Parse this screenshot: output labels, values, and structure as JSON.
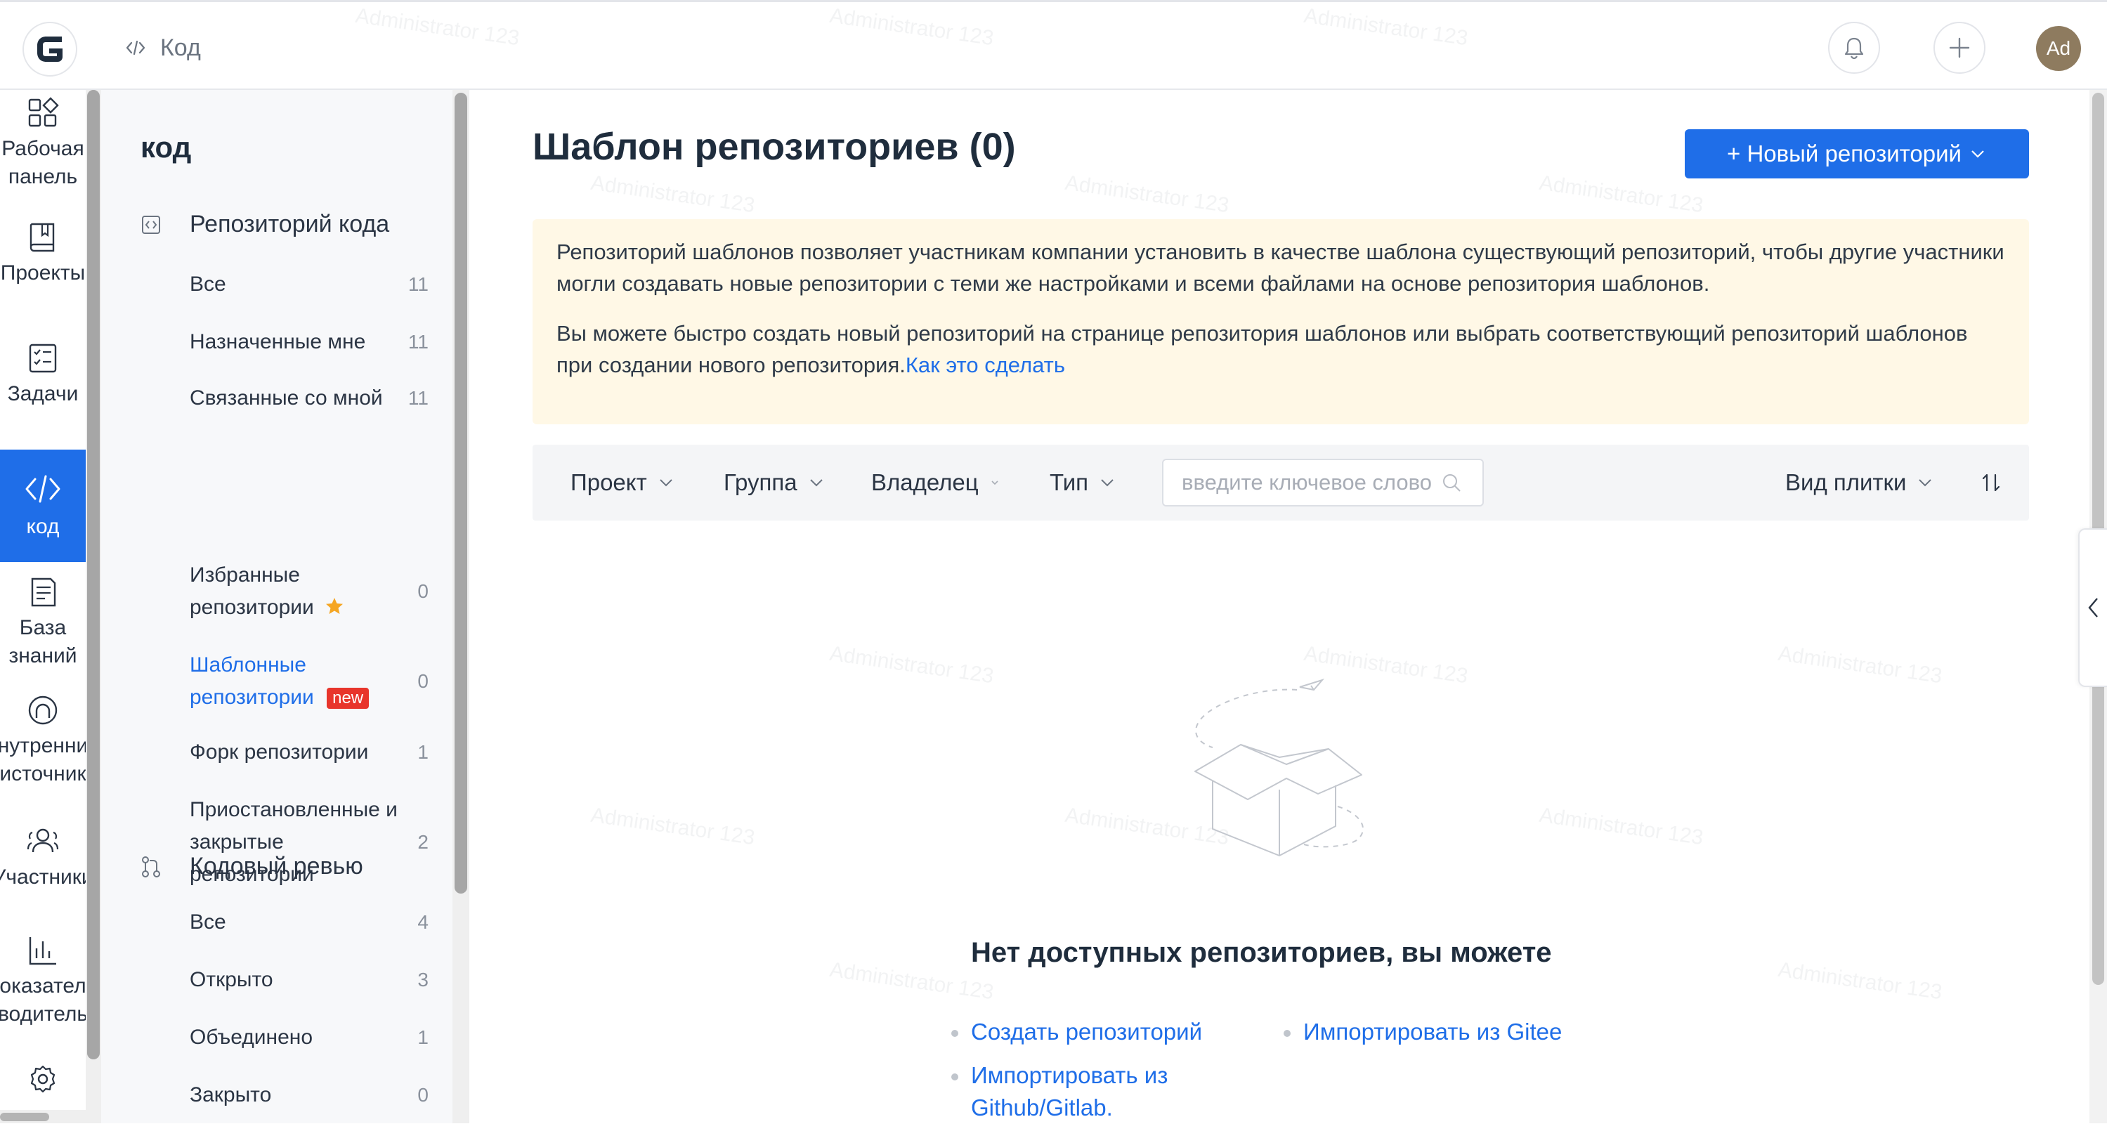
{
  "header": {
    "breadcrumb": "Код",
    "avatar_initials": "Ad"
  },
  "rail": {
    "items": [
      {
        "label_line1": "Рабочая",
        "label_line2": "панель",
        "icon": "dashboard-icon"
      },
      {
        "label_line1": "Проекты",
        "label_line2": "",
        "icon": "book-icon"
      },
      {
        "label_line1": "Задачи",
        "label_line2": "",
        "icon": "checklist-icon"
      },
      {
        "label_line1": "код",
        "label_line2": "",
        "icon": "code-icon"
      },
      {
        "label_line1": "База",
        "label_line2": "знаний",
        "icon": "document-icon"
      },
      {
        "label_line1": "нутренни",
        "label_line2": "источник",
        "icon": "source-icon"
      },
      {
        "label_line1": "Участники",
        "label_line2": "",
        "icon": "members-icon"
      },
      {
        "label_line1": "оказател",
        "label_line2": "водитель",
        "icon": "chart-icon"
      }
    ]
  },
  "sidebar": {
    "title": "код",
    "repos": {
      "heading": "Репозиторий кода",
      "items": [
        {
          "label": "Все",
          "count": "11"
        },
        {
          "label": "Назначенные мне",
          "count": "11"
        },
        {
          "label": "Связанные со мной",
          "count": "11"
        },
        {
          "label": "Избранные репозитории",
          "count": "0"
        },
        {
          "label": "Шаблонные репозитории",
          "count": "0",
          "badge": "new"
        },
        {
          "label": "Форк репозитории",
          "count": "1"
        },
        {
          "label": "Приостановленные и закрытые репозитории",
          "count": "2"
        }
      ]
    },
    "review": {
      "heading": "Кодовый ревью",
      "items": [
        {
          "label": "Все",
          "count": "4"
        },
        {
          "label": "Открыто",
          "count": "3"
        },
        {
          "label": "Объединено",
          "count": "1"
        },
        {
          "label": "Закрыто",
          "count": "0"
        }
      ]
    }
  },
  "main": {
    "title": "Шаблон репозиториев (0)",
    "new_repo_button": "+ Новый репозиторий",
    "notice": {
      "paragraph1": "Репозиторий шаблонов позволяет участникам компании установить в качестве шаблона существующий репозиторий, чтобы другие участники могли создавать новые репозитории с теми же настройками и всеми файлами на основе репозитория шаблонов.",
      "paragraph2": "Вы можете быстро создать новый репозиторий на странице репозитория шаблонов или выбрать соответствующий репозиторий шаблонов при создании нового репозитория.",
      "link": "Как это сделать"
    },
    "filters": {
      "project": "Проект",
      "group": "Группа",
      "owner": "Владелец",
      "type": "Тип",
      "search_placeholder": "введите ключевое слово",
      "view": "Вид плитки"
    },
    "empty": {
      "title": "Нет доступных репозиториев, вы можете",
      "link_create": "Создать репозиторий",
      "link_import_gitee": "Импортировать из Gitee",
      "link_import_github_line1": "Импортировать из",
      "link_import_github_line2": "Github/Gitlab."
    }
  },
  "watermark": "Administrator 123",
  "colors": {
    "accent": "#1f6ee8",
    "notice_bg": "#fff8e6",
    "badge_new": "#e8352b",
    "star": "#f5a623"
  }
}
